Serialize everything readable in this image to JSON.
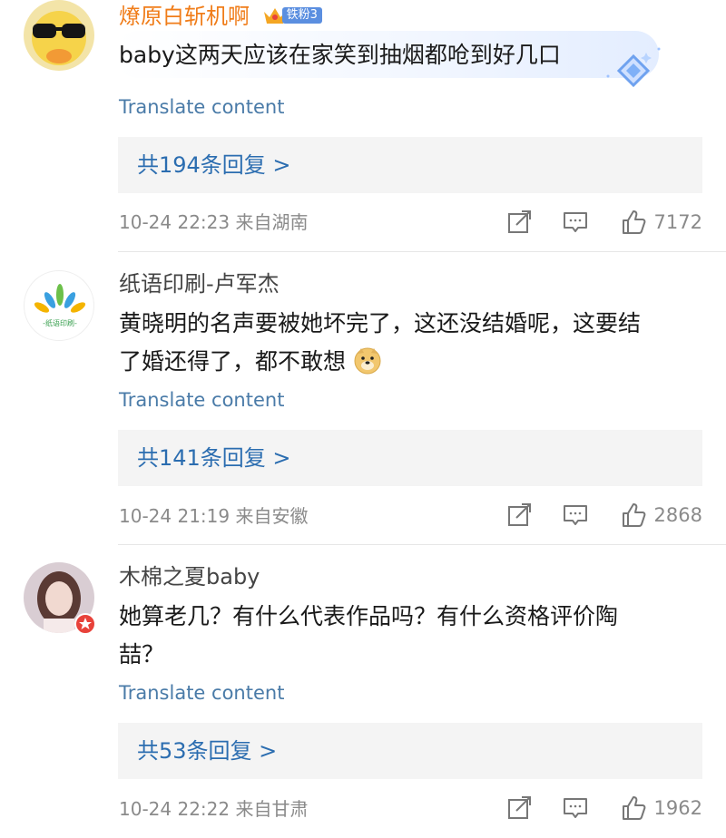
{
  "comments": [
    {
      "username": "燎原白斩机啊",
      "fan_badge": "铁粉3",
      "text": "baby这两天应该在家笑到抽烟都呛到好几口",
      "translate": "Translate content",
      "replies": "共194条回复 >",
      "meta": "10-24 22:23  来自湖南",
      "likes": "7172"
    },
    {
      "username": "纸语印刷-卢军杰",
      "avatar_text": "-纸语印刷-",
      "text_line1": "黄晓明的名声要被她坏完了，这还没结婚呢，这要结",
      "text_line2": "了婚还得了，都不敢想",
      "translate": "Translate content",
      "replies": "共141条回复 >",
      "meta": "10-24 21:19  来自安徽",
      "likes": "2868"
    },
    {
      "username": "木棉之夏baby",
      "text_line1": "她算老几？有什么代表作品吗？有什么资格评价陶",
      "text_line2": "喆？",
      "translate": "Translate content",
      "replies": "共53条回复 >",
      "meta": "10-24 22:22  来自甘肃",
      "likes": "1962"
    }
  ],
  "icons": [
    "repost-icon",
    "comment-icon",
    "like-icon",
    "emoji-doge-icon",
    "crown-icon",
    "diamond-decoration-icon"
  ],
  "colors": {
    "vip_name": "#f07d1a",
    "link": "#4a7ba8",
    "reply": "#2b6db0",
    "meta": "#8a8a8a",
    "badge": "#5b8fe0"
  }
}
